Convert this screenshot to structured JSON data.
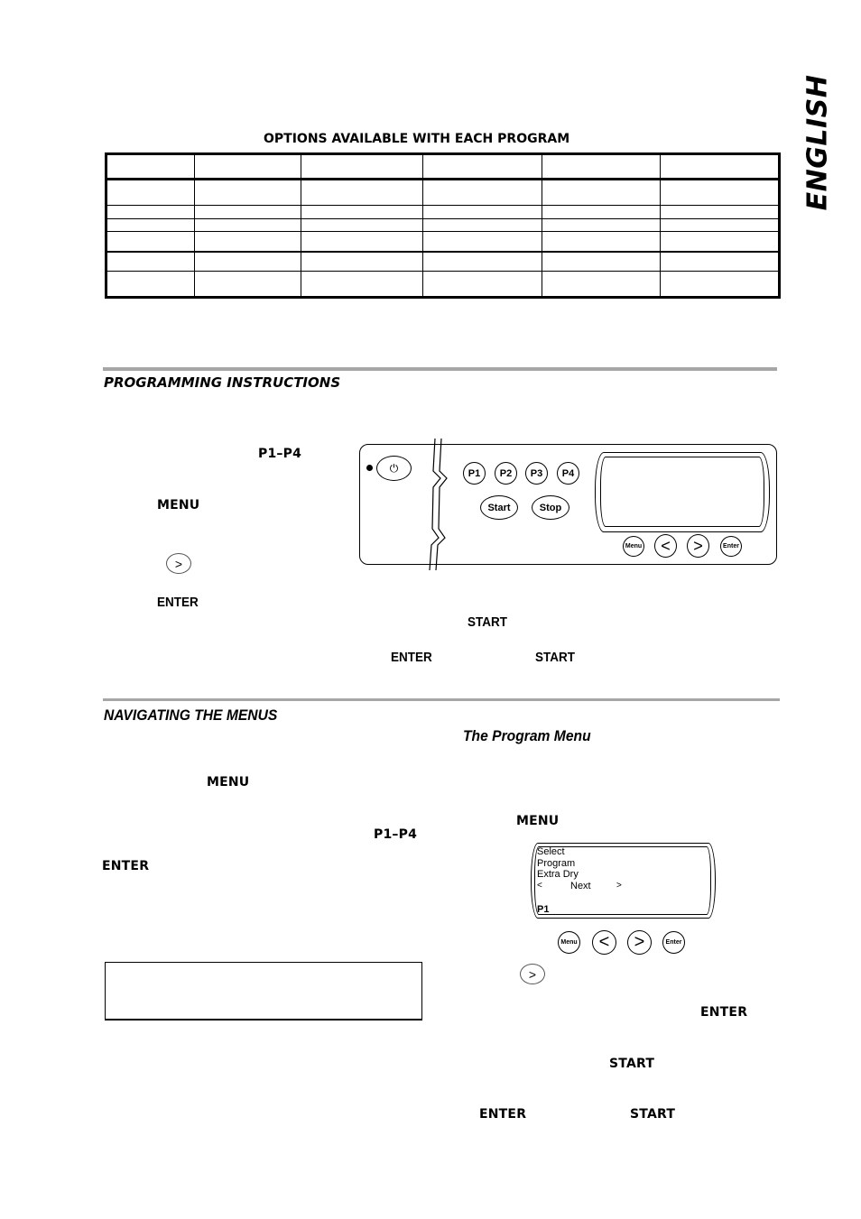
{
  "side_tab": {
    "label": "ENGLISH"
  },
  "options_table": {
    "title": "OPTIONS AVAILABLE WITH EACH PROGRAM",
    "columns": 6,
    "header": [
      "",
      "",
      "",
      "",
      "",
      ""
    ],
    "rows": [
      [
        "",
        "",
        "",
        "",
        "",
        ""
      ],
      [
        "",
        "",
        "",
        "",
        "",
        ""
      ],
      [
        "",
        "",
        "",
        "",
        "",
        ""
      ],
      [
        "",
        "",
        "",
        "",
        "",
        ""
      ],
      [
        "",
        "",
        "",
        "",
        "",
        ""
      ],
      [
        "",
        "",
        "",
        "",
        "",
        ""
      ]
    ]
  },
  "programming": {
    "heading": "PROGRAMMING INSTRUCTIONS",
    "keywords": {
      "p1_p4": "P1–P4",
      "menu": "MENU",
      "enter": "ENTER",
      "start": "START",
      "enter_2": "ENTER",
      "start_2": "START"
    },
    "next_icon_glyph": ">"
  },
  "control_panel": {
    "power_glyph": "⏻",
    "program_buttons": [
      "P1",
      "P2",
      "P3",
      "P4"
    ],
    "start_label": "Start",
    "stop_label": "Stop",
    "menu_label": "Menu",
    "prev_glyph": "<",
    "next_glyph": ">",
    "enter_label": "Enter"
  },
  "navigating": {
    "heading": "NAVIGATING THE MENUS",
    "keywords": {
      "menu": "MENU",
      "p1_p4": "P1–P4",
      "enter": "ENTER"
    }
  },
  "program_menu": {
    "heading": "The Program Menu",
    "keywords": {
      "menu": "MENU",
      "enter": "ENTER",
      "start": "START",
      "enter_2": "ENTER",
      "start_2": "START"
    },
    "display": {
      "line1": "Select",
      "line2": "Program",
      "line3": "Extra Dry",
      "nav_left": "<",
      "nav_label": "Next",
      "nav_right": ">",
      "program": "P1"
    },
    "buttons": {
      "menu_label": "Menu",
      "prev_glyph": "<",
      "next_glyph": ">",
      "enter_label": "Enter"
    },
    "next_icon_glyph": ">"
  }
}
